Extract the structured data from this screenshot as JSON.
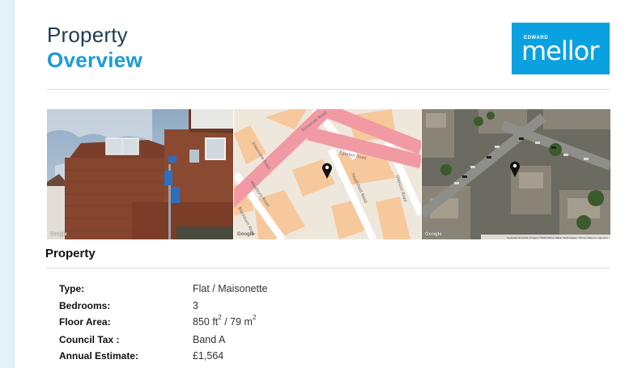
{
  "header": {
    "title_line1": "Property",
    "title_line2": "Overview"
  },
  "logo": {
    "small_text": "EDWARD",
    "main_text": "mellor",
    "color": "#0aa1e0"
  },
  "images": {
    "street_view": {
      "watermark": "Google"
    },
    "map": {
      "watermark": "Google",
      "roads": [
        "Ellesmere Road",
        "Somerset Road",
        "Egerton Road",
        "Heathfield Road",
        "Westbury Road",
        "Blackburn Road",
        "Glencoe Road"
      ]
    },
    "satellite": {
      "watermark": "Google",
      "copyright": "Keyboard shortcuts | Imagery ©2024 Airbus, Maxar Technologies | Terms | Report a map error"
    }
  },
  "section": {
    "heading": "Property"
  },
  "property": {
    "rows": [
      {
        "label": "Type:",
        "value": "Flat / Maisonette"
      },
      {
        "label": "Bedrooms:",
        "value": "3"
      },
      {
        "label": "Floor Area:",
        "value_ft": "850 ft",
        "value_sep": " / ",
        "value_m": "79 m",
        "unit_exp": "2"
      },
      {
        "label": "Council Tax :",
        "value": "Band A"
      },
      {
        "label": "Annual Estimate:",
        "value": "£1,564"
      }
    ]
  },
  "colors": {
    "accent": "#1a9bd7",
    "title_dark": "#1f3d55",
    "background_strip": "#e3f1f8"
  }
}
